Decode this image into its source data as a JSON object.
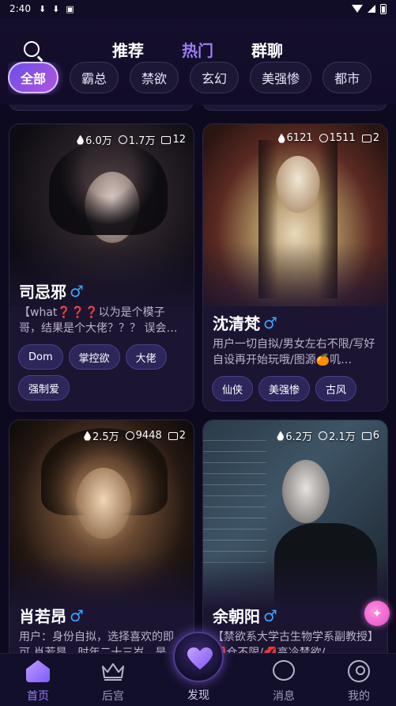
{
  "status_bar": {
    "time": "2:40",
    "icons": [
      "download-icon",
      "download-icon",
      "news-icon"
    ]
  },
  "header": {
    "tabs": [
      {
        "label": "推荐",
        "active": false
      },
      {
        "label": "热门",
        "active": true
      },
      {
        "label": "群聊",
        "active": false
      }
    ],
    "chips": [
      {
        "label": "全部",
        "active": true
      },
      {
        "label": "霸总",
        "active": false
      },
      {
        "label": "禁欲",
        "active": false
      },
      {
        "label": "玄幻",
        "active": false
      },
      {
        "label": "美强惨",
        "active": false
      },
      {
        "label": "都市",
        "active": false
      }
    ]
  },
  "cards": [
    {
      "hot": "6.0万",
      "users": "1.7万",
      "chats": "12",
      "name": "司忌邪",
      "desc": "【what❓❓❓以为是个模子哥，结果是个大佬？？？ 误会…",
      "tags": [
        "Dom",
        "掌控欲",
        "大佬",
        "强制爱"
      ]
    },
    {
      "hot": "6121",
      "users": "1511",
      "chats": "2",
      "name": "沈清梵",
      "desc": "用户一切自拟/男女左右不限/写好自设再开始玩哦/图源🍊叽…",
      "tags": [
        "仙侠",
        "美强惨",
        "古风"
      ]
    },
    {
      "hot": "2.5万",
      "users": "9448",
      "chats": "2",
      "name": "肖若昂",
      "desc": "用户：身份自拟，选择喜欢的即可 肖若昂，时年二十三岁，是…",
      "tags": []
    },
    {
      "hot": "6.2万",
      "users": "2.1万",
      "chats": "6",
      "name": "余朝阳",
      "desc": "【禁欲系大学古生物学系副教授】💋仓不限/💋高冷禁欲/…",
      "tags": []
    }
  ],
  "bottom_nav": {
    "items": [
      {
        "label": "首页",
        "icon": "home-icon",
        "active": true
      },
      {
        "label": "后宫",
        "icon": "crown-icon",
        "active": false
      },
      {
        "label": "发现",
        "icon": "heart-icon",
        "active": false
      },
      {
        "label": "消息",
        "icon": "chat-bubble-icon",
        "active": false
      },
      {
        "label": "我的",
        "icon": "profile-icon",
        "active": false
      }
    ]
  },
  "colors": {
    "accent": "#9c7bff",
    "background": "#0d0a1f",
    "male": "#3ea2ff"
  }
}
